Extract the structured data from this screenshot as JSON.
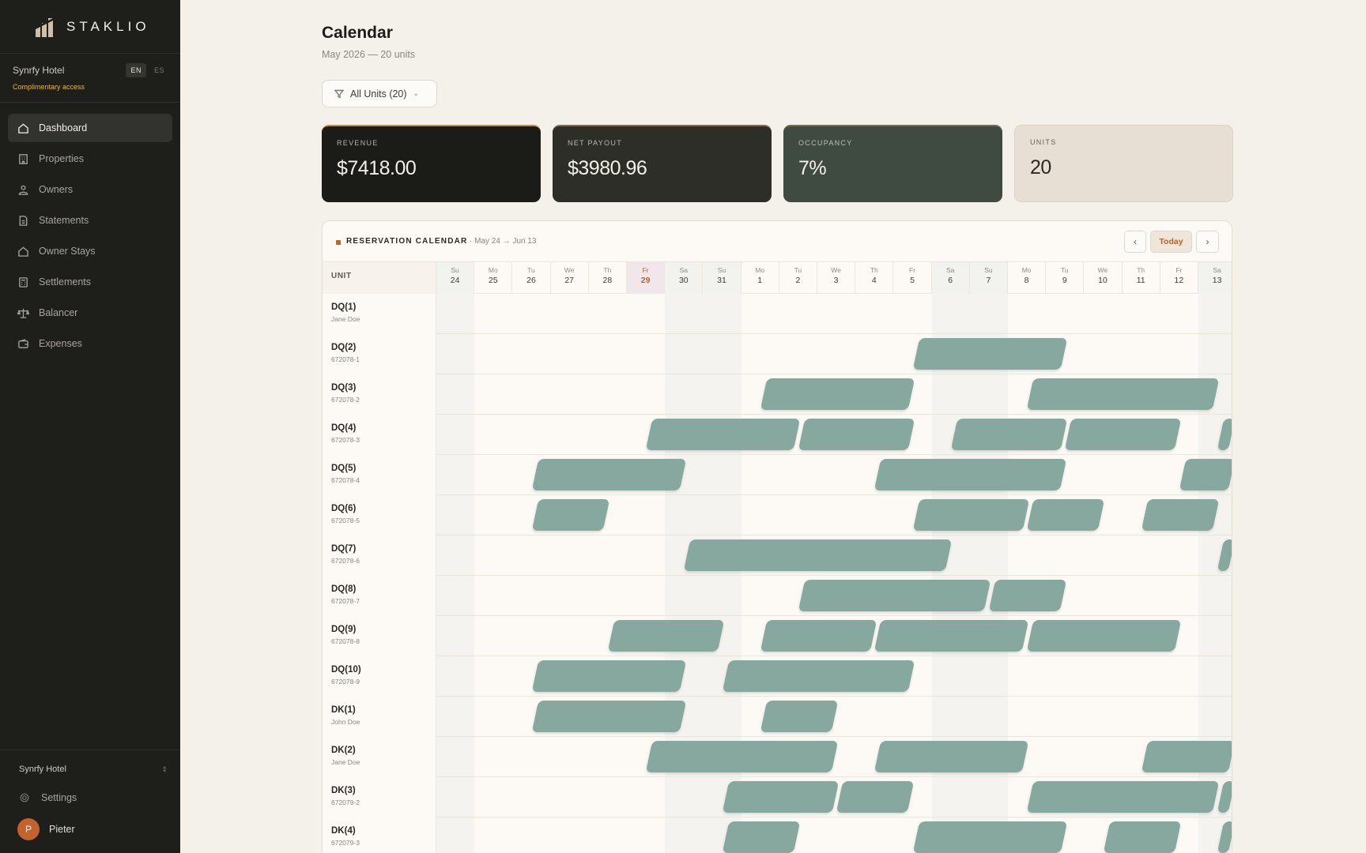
{
  "brand": {
    "name": "STAKLIO"
  },
  "org": {
    "name": "Synrfy Hotel",
    "access": "Complimentary access",
    "langs": [
      "EN",
      "ES"
    ]
  },
  "nav": [
    {
      "label": "Dashboard",
      "icon": "home-icon",
      "active": true
    },
    {
      "label": "Properties",
      "icon": "building-icon"
    },
    {
      "label": "Owners",
      "icon": "owners-icon"
    },
    {
      "label": "Statements",
      "icon": "document-icon"
    },
    {
      "label": "Owner Stays",
      "icon": "home-icon"
    },
    {
      "label": "Settlements",
      "icon": "calculator-icon"
    },
    {
      "label": "Balancer",
      "icon": "scale-icon"
    },
    {
      "label": "Expenses",
      "icon": "wallet-icon"
    }
  ],
  "footer": {
    "hotel": "Synrfy Hotel",
    "settings": "Settings",
    "user": "Pieter",
    "initial": "P"
  },
  "page": {
    "title": "Calendar",
    "subtitle": "May 2026 — 20 units",
    "filter": "All Units (20)"
  },
  "kpis": [
    {
      "label": "REVENUE",
      "value": "$7418.00"
    },
    {
      "label": "NET PAYOUT",
      "value": "$3980.96"
    },
    {
      "label": "OCCUPANCY",
      "value": "7%"
    },
    {
      "label": "UNITS",
      "value": "20"
    }
  ],
  "calendar": {
    "title": "RESERVATION CALENDAR",
    "range": "· May 24 → Jun 13",
    "today_label": "Today",
    "unit_header": "UNIT",
    "days": [
      {
        "dn": "Su",
        "dd": "24",
        "wk": true
      },
      {
        "dn": "Mo",
        "dd": "25"
      },
      {
        "dn": "Tu",
        "dd": "26"
      },
      {
        "dn": "We",
        "dd": "27"
      },
      {
        "dn": "Th",
        "dd": "28"
      },
      {
        "dn": "Fr",
        "dd": "29",
        "today": true
      },
      {
        "dn": "Sa",
        "dd": "30",
        "wk": true
      },
      {
        "dn": "Su",
        "dd": "31",
        "wk": true
      },
      {
        "dn": "Mo",
        "dd": "1"
      },
      {
        "dn": "Tu",
        "dd": "2"
      },
      {
        "dn": "We",
        "dd": "3"
      },
      {
        "dn": "Th",
        "dd": "4"
      },
      {
        "dn": "Fr",
        "dd": "5"
      },
      {
        "dn": "Sa",
        "dd": "6",
        "wk": true
      },
      {
        "dn": "Su",
        "dd": "7",
        "wk": true
      },
      {
        "dn": "Mo",
        "dd": "8"
      },
      {
        "dn": "Tu",
        "dd": "9"
      },
      {
        "dn": "We",
        "dd": "10"
      },
      {
        "dn": "Th",
        "dd": "11"
      },
      {
        "dn": "Fr",
        "dd": "12"
      },
      {
        "dn": "Sa",
        "dd": "13",
        "wk": true
      }
    ],
    "units": [
      {
        "name": "DQ(1)",
        "sub": "Jane Doe",
        "stays": []
      },
      {
        "name": "DQ(2)",
        "sub": "672078-1",
        "stays": [
          [
            12.5,
            4
          ]
        ]
      },
      {
        "name": "DQ(3)",
        "sub": "672078-2",
        "stays": [
          [
            8.5,
            4
          ],
          [
            15.5,
            5
          ]
        ]
      },
      {
        "name": "DQ(4)",
        "sub": "672078-3",
        "stays": [
          [
            5.5,
            4
          ],
          [
            9.5,
            3
          ],
          [
            13.5,
            3
          ],
          [
            16.5,
            3
          ],
          [
            20.5,
            1
          ]
        ]
      },
      {
        "name": "DQ(5)",
        "sub": "672078-4",
        "stays": [
          [
            2.5,
            4
          ],
          [
            11.5,
            5
          ],
          [
            19.5,
            2
          ]
        ]
      },
      {
        "name": "DQ(6)",
        "sub": "672078-5",
        "stays": [
          [
            2.5,
            2
          ],
          [
            12.5,
            3
          ],
          [
            15.5,
            2
          ],
          [
            18.5,
            2
          ]
        ]
      },
      {
        "name": "DQ(7)",
        "sub": "672078-6",
        "stays": [
          [
            6.5,
            7
          ],
          [
            20.5,
            1
          ]
        ]
      },
      {
        "name": "DQ(8)",
        "sub": "672078-7",
        "stays": [
          [
            9.5,
            5
          ],
          [
            14.5,
            2
          ]
        ]
      },
      {
        "name": "DQ(9)",
        "sub": "672078-8",
        "stays": [
          [
            4.5,
            3
          ],
          [
            8.5,
            3
          ],
          [
            11.5,
            4
          ],
          [
            15.5,
            4
          ]
        ]
      },
      {
        "name": "DQ(10)",
        "sub": "672078-9",
        "stays": [
          [
            2.5,
            4
          ],
          [
            7.5,
            5
          ]
        ]
      },
      {
        "name": "DK(1)",
        "sub": "John Doe",
        "stays": [
          [
            2.5,
            4
          ],
          [
            8.5,
            2
          ]
        ]
      },
      {
        "name": "DK(2)",
        "sub": "Jane Doe",
        "stays": [
          [
            5.5,
            5
          ],
          [
            11.5,
            4
          ],
          [
            18.5,
            3
          ]
        ]
      },
      {
        "name": "DK(3)",
        "sub": "672079-2",
        "stays": [
          [
            7.5,
            3
          ],
          [
            10.5,
            2
          ],
          [
            15.5,
            5
          ],
          [
            20.5,
            1
          ]
        ]
      },
      {
        "name": "DK(4)",
        "sub": "672079-3",
        "stays": [
          [
            7.5,
            2
          ],
          [
            12.5,
            4
          ],
          [
            17.5,
            2
          ],
          [
            20.5,
            1
          ]
        ]
      }
    ]
  }
}
